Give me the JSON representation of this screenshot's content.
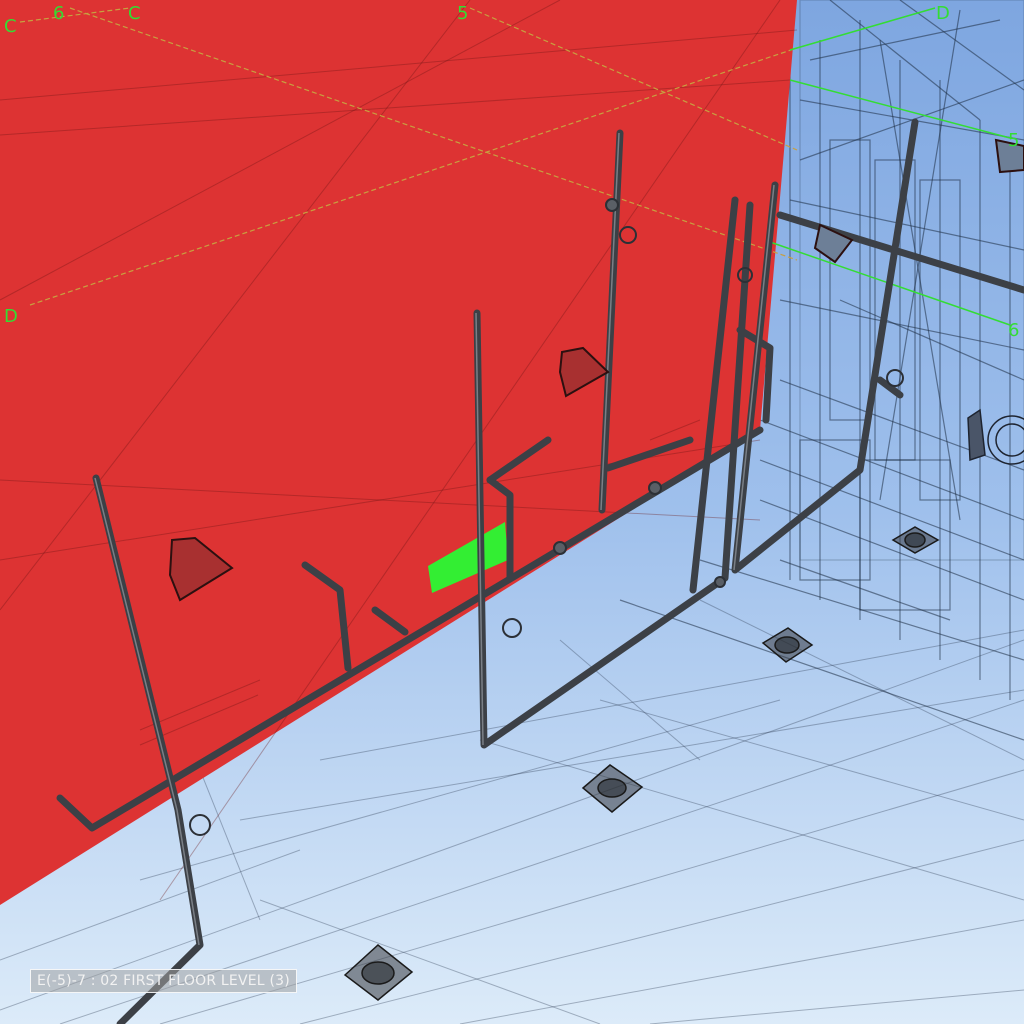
{
  "viewport": {
    "view_name": "E(-5)-7 : 02 FIRST FLOOR LEVEL (3)"
  },
  "grid_labels": {
    "c_left": "C",
    "six_left": "6",
    "c_top": "C",
    "five_top": "5",
    "d_top": "D",
    "d_left": "D",
    "five_right": "5",
    "six_right": "6"
  },
  "colors": {
    "wall": "#dd3333",
    "selection": "#33ee33",
    "grid_line": "#c8a040",
    "grid_line_active": "#33dd33",
    "pipe": "#3c4046",
    "wireframe": "#24344a",
    "floor_top": "#8fb4e6",
    "floor_bottom": "#dbe9f8"
  }
}
